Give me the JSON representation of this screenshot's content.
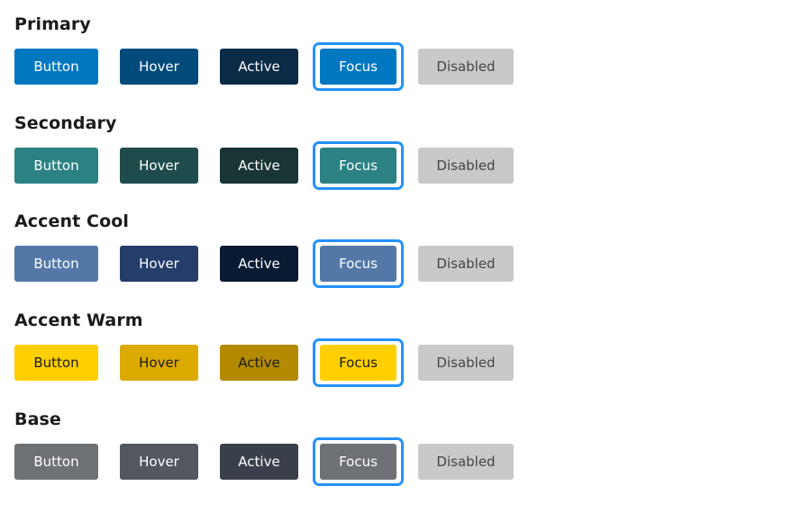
{
  "groups": [
    {
      "title": "Primary",
      "labels": {
        "button": "Button",
        "hover": "Hover",
        "active": "Active",
        "focus": "Focus",
        "disabled": "Disabled"
      },
      "colors": {
        "button": "#0078c1",
        "hover": "#004b7c",
        "active": "#0a2a45",
        "focus": "#0078c1",
        "disabled": "#c9c9c9"
      },
      "text": {
        "button": "#ffffff",
        "hover": "#ffffff",
        "active": "#ffffff",
        "focus": "#ffffff",
        "disabled": "#454545"
      }
    },
    {
      "title": "Secondary",
      "labels": {
        "button": "Button",
        "hover": "Hover",
        "active": "Active",
        "focus": "Focus",
        "disabled": "Disabled"
      },
      "colors": {
        "button": "#2c8282",
        "hover": "#1e4c4c",
        "active": "#193536",
        "focus": "#2c8282",
        "disabled": "#c9c9c9"
      },
      "text": {
        "button": "#ffffff",
        "hover": "#ffffff",
        "active": "#ffffff",
        "focus": "#ffffff",
        "disabled": "#454545"
      }
    },
    {
      "title": "Accent Cool",
      "labels": {
        "button": "Button",
        "hover": "Hover",
        "active": "Active",
        "focus": "Focus",
        "disabled": "Disabled"
      },
      "colors": {
        "button": "#5378a8",
        "hover": "#243d6a",
        "active": "#091a33",
        "focus": "#5378a8",
        "disabled": "#c9c9c9"
      },
      "text": {
        "button": "#ffffff",
        "hover": "#ffffff",
        "active": "#ffffff",
        "focus": "#ffffff",
        "disabled": "#454545"
      }
    },
    {
      "title": "Accent Warm",
      "labels": {
        "button": "Button",
        "hover": "Hover",
        "active": "Active",
        "focus": "Focus",
        "disabled": "Disabled"
      },
      "colors": {
        "button": "#ffcf00",
        "hover": "#ddaa00",
        "active": "#b38a00",
        "focus": "#ffcf00",
        "disabled": "#c9c9c9"
      },
      "text": {
        "button": "#1b1b1b",
        "hover": "#1b1b1b",
        "active": "#1b1b1b",
        "focus": "#1b1b1b",
        "disabled": "#454545"
      }
    },
    {
      "title": "Base",
      "labels": {
        "button": "Button",
        "hover": "Hover",
        "active": "Active",
        "focus": "Focus",
        "disabled": "Disabled"
      },
      "colors": {
        "button": "#6e7175",
        "hover": "#525760",
        "active": "#3a4049",
        "focus": "#6e7175",
        "disabled": "#c9c9c9"
      },
      "text": {
        "button": "#ffffff",
        "hover": "#ffffff",
        "active": "#ffffff",
        "focus": "#ffffff",
        "disabled": "#454545"
      }
    }
  ],
  "focus_ring_color": "#2491ff"
}
